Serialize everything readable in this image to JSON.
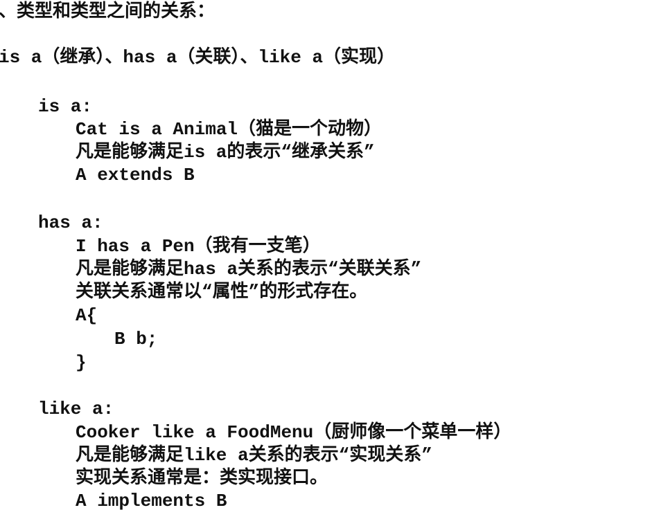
{
  "doc": {
    "heading": "、类型和类型之间的关系：",
    "summary": "is a（继承）、has a（关联）、like a（实现）",
    "is_a": {
      "label": "is a:",
      "example": "Cat is a Animal（猫是一个动物）",
      "rule": "凡是能够满足is a的表示“继承关系”",
      "code": "A extends B"
    },
    "has_a": {
      "label": "has a:",
      "example": "I has a Pen（我有一支笔）",
      "rule": "凡是能够满足has a关系的表示“关联关系”",
      "note": "关联关系通常以“属性”的形式存在。",
      "code_open": "A{",
      "code_body": "B b;",
      "code_close": "}"
    },
    "like_a": {
      "label": "like a:",
      "example": "Cooker like a FoodMenu（厨师像一个菜单一样）",
      "rule": "凡是能够满足like a关系的表示“实现关系”",
      "note": "实现关系通常是：类实现接口。",
      "code": "A implements B"
    }
  }
}
